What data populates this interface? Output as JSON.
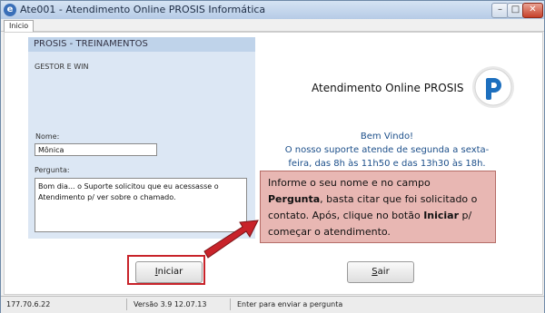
{
  "window": {
    "title": "Ate001 - Atendimento Online PROSIS Informática",
    "app_icon": "app-icon-e"
  },
  "titlebar_buttons": {
    "minimize": "–",
    "maximize": "□",
    "close": "✕"
  },
  "tabs": [
    {
      "label": "Inicio"
    }
  ],
  "panel": {
    "title": "PROSIS - TREINAMENTOS",
    "subtitle": "GESTOR E WIN",
    "name_label": "Nome:",
    "name_value": "Mônica",
    "question_label": "Pergunta:",
    "question_value": "Bom dia... o Suporte solicitou que eu acessasse o Atendimento p/ ver sobre o chamado."
  },
  "heading": "Atendimento Online PROSIS",
  "welcome": {
    "line1": "Bem Vindo!",
    "line2": "O nosso suporte atende de segunda a sexta-",
    "line3": "feira, das 8h às 11h50 e das 13h30 às 18h."
  },
  "callout": {
    "part1": "Informe o seu nome e no campo ",
    "bold1": "Pergunta",
    "part2": ", basta citar que foi solicitado o contato. Após, clique no botão ",
    "bold2": "Iniciar",
    "part3": " p/ começar o atendimento."
  },
  "buttons": {
    "iniciar": {
      "accel": "I",
      "rest": "niciar"
    },
    "sair": {
      "accel": "S",
      "rest": "air"
    }
  },
  "statusbar": {
    "ip": "177.70.6.22",
    "version": "Versão 3.9 12.07.13",
    "hint": "Enter para enviar a pergunta"
  },
  "colors": {
    "highlight": "#c8232a",
    "callout_bg": "#e8b7b3",
    "welcome_text": "#1c4f8a",
    "panel_bg": "#dce7f4",
    "logo_blue": "#1d6fbe"
  }
}
